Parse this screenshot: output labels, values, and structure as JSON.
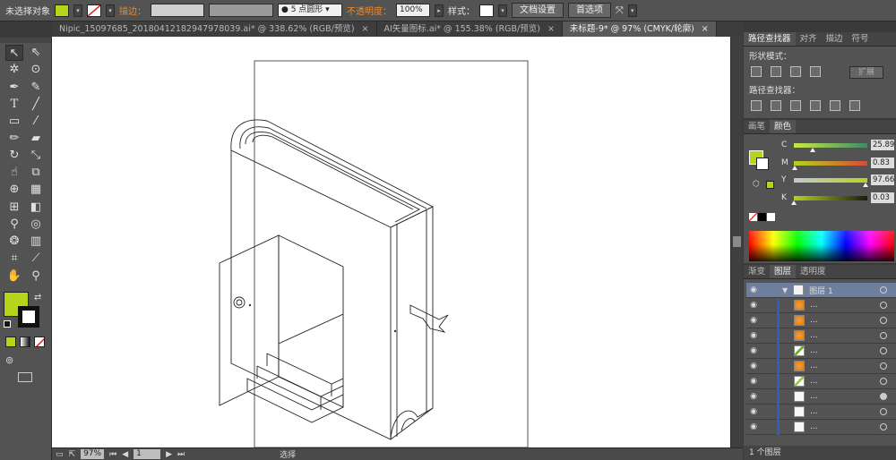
{
  "control_bar": {
    "selection_status": "未选择对象",
    "fill_color": "#b6d41a",
    "stroke_label": "描边：",
    "brush_value": "5 点圆形",
    "opacity_label": "不透明度：",
    "opacity_value": "100%",
    "style_label": "样式：",
    "doc_setup": "文档设置",
    "preferences": "首选项"
  },
  "doc_tabs": [
    {
      "label": "Nipic_15097685_20180412182947978039.ai* @ 338.62% (RGB/预览)",
      "close": "×"
    },
    {
      "label": "AI矢量图标.ai* @ 155.38% (RGB/预览)",
      "close": "×"
    },
    {
      "label": "未标题-9* @ 97% (CMYK/轮廓)",
      "close": "×"
    }
  ],
  "toolbar": {
    "fill_swatch": "#b6d41a",
    "icons": [
      "selection-icon",
      "direct-selection-icon",
      "magic-wand-icon",
      "lasso-icon",
      "pen-icon",
      "curvature-icon",
      "type-icon",
      "line-icon",
      "rectangle-icon",
      "paintbrush-icon",
      "pencil-icon",
      "eraser-icon",
      "rotate-icon",
      "scale-icon",
      "warp-icon",
      "free-transform-icon",
      "shape-builder-icon",
      "perspective-grid-icon",
      "mesh-icon",
      "gradient-icon",
      "eyedropper-icon",
      "blend-icon",
      "symbol-sprayer-icon",
      "column-graph-icon",
      "artboard-icon",
      "slice-icon",
      "hand-icon",
      "zoom-icon"
    ]
  },
  "pathfinder_panel": {
    "tabs": [
      "路径查找器",
      "对齐",
      "描边",
      "符号"
    ],
    "shape_modes_label": "形状模式：",
    "expand_label": "扩展",
    "pathfinders_label": "路径查找器："
  },
  "color_panel": {
    "tabs": [
      "画笔",
      "颜色"
    ],
    "fill_color": "#b6d41a",
    "channels": [
      {
        "label": "C",
        "value": "25.89",
        "level": 0.26,
        "gradient": "linear-gradient(to right,#c8e84a,#3d8a6b)"
      },
      {
        "label": "M",
        "value": "0.83",
        "level": 0.01,
        "gradient": "linear-gradient(to right,#b6d41a,#d94a3a)"
      },
      {
        "label": "Y",
        "value": "97.66",
        "level": 0.98,
        "gradient": "linear-gradient(to right,#c0c8d8,#b6d41a)"
      },
      {
        "label": "K",
        "value": "0.03",
        "level": 0.0,
        "gradient": "linear-gradient(to right,#b6d41a,#1a1a10)"
      }
    ]
  },
  "layers_panel": {
    "tabs": [
      "渐变",
      "图层",
      "透明度"
    ],
    "layer_name": "图层 1",
    "sublayer_label": "...",
    "footer": "1 个图层"
  },
  "status_bar": {
    "zoom": "97%",
    "page": "1",
    "tool_label": "选择"
  }
}
